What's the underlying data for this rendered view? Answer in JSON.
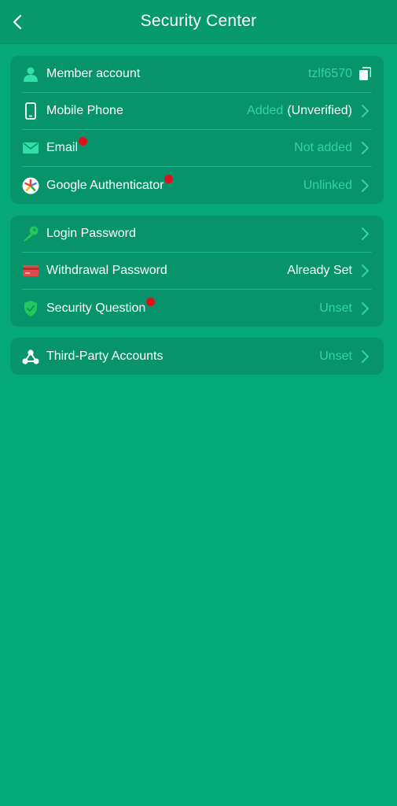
{
  "header": {
    "title": "Security Center"
  },
  "group1": {
    "member_account": {
      "label": "Member account",
      "value": "tzlf6570"
    },
    "mobile_phone": {
      "label": "Mobile Phone",
      "value_muted": "Added",
      "value_white": "(Unverified)"
    },
    "email": {
      "label": "Email",
      "value": "Not added"
    },
    "google_auth": {
      "label": "Google Authenticator",
      "value": "Unlinked"
    }
  },
  "group2": {
    "login_password": {
      "label": "Login Password"
    },
    "withdrawal_password": {
      "label": "Withdrawal Password",
      "value": "Already Set"
    },
    "security_question": {
      "label": "Security Question",
      "value": "Unset"
    }
  },
  "group3": {
    "third_party": {
      "label": "Third-Party Accounts",
      "value": "Unset"
    }
  },
  "colors": {
    "background": "#05a877",
    "header": "#06996b",
    "card": "#07946a",
    "muted_text": "#33d3a4",
    "notification_dot": "#e0101a"
  }
}
